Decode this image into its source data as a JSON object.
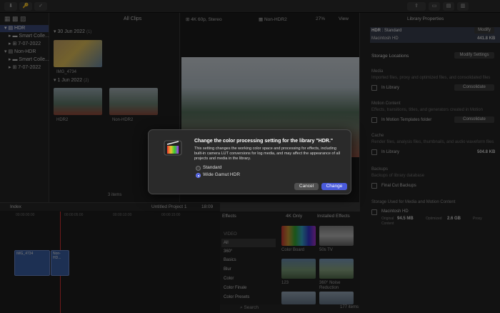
{
  "toolbar": {
    "buttons": [
      "⬇",
      "🔑",
      "✓"
    ],
    "library_properties": "Library Properties"
  },
  "browser": {
    "filter": "All Clips",
    "library_tree": [
      {
        "label": "HDR",
        "selected": true
      },
      {
        "label": "Smart Colle..."
      },
      {
        "label": "7-07-2022"
      },
      {
        "label": "Non-HDR"
      },
      {
        "label": "Smart Colle..."
      },
      {
        "label": "7-07-2022"
      }
    ],
    "events": [
      {
        "date": "30 Jun 2022",
        "count": "(1)",
        "clips": [
          "IMG_4734"
        ]
      },
      {
        "date": "1 Jun 2022",
        "count": "(2)",
        "clips": [
          "HDR2",
          "Non-HDR2"
        ]
      }
    ],
    "item_count": "3 items"
  },
  "viewer": {
    "format": "4K 60p, Stereo",
    "clip_name": "Non-HDR2",
    "zoom": "27%",
    "view": "View"
  },
  "inspector": {
    "library_name": "HDR",
    "library_format": "Standard",
    "modify_label": "Modify",
    "drive": "Macintosh HD",
    "drive_size": "441.8 KB",
    "storage_locations": "Storage Locations",
    "modify_settings": "Modify Settings",
    "sections": [
      {
        "title": "Media",
        "desc": "Imported files, proxy and optimized files, and consolidated files",
        "location": "In Library",
        "button": "Consolidate"
      },
      {
        "title": "Motion Content",
        "desc": "Effects, transitions, titles, and generators created in Motion",
        "location": "In Motion Templates folder",
        "button": "Consolidate"
      },
      {
        "title": "Cache",
        "desc": "Render files, analysis files, thumbnails, and audio waveform files",
        "location": "In Library",
        "value": "504.8 KB"
      },
      {
        "title": "Backups",
        "desc": "Backups of library database",
        "location": "Final Cut Backups"
      }
    ],
    "storage_used": "Storage Used for Media and Motion Content",
    "storage_drive": "Macintosh HD",
    "original_label": "Original",
    "original_value": "94.5 MB",
    "optimized_label": "Optimized",
    "optimized_value": "2.6 GB",
    "proxy_label": "Proxy",
    "content_label": "Content"
  },
  "timeline": {
    "index_label": "Index",
    "project": "Untitled Project 1",
    "timecode": "18:09",
    "ruler": [
      "00:00:00:00",
      "00:00:05:00",
      "00:00:10:00",
      "00:00:15:00"
    ],
    "clips": [
      "IMG_4734",
      "Non-HD..."
    ]
  },
  "effects": {
    "title": "Effects",
    "filter": "4K Only",
    "installed": "Installed Effects",
    "categories": [
      "VIDEO",
      "All",
      "360°",
      "Basics",
      "Blur",
      "Color",
      "Color Finale",
      "Color Presets"
    ],
    "items": [
      "Color Board",
      "50s TV",
      "123",
      "360° Noise Reduction"
    ],
    "search": "Search",
    "count": "177 items"
  },
  "dialog": {
    "title": "Change the color processing setting for the library \"HDR.\"",
    "body": "This setting changes the working color space and processing for effects, including built-in camera LUT conversions for log media, and may affect the appearance of all projects and media in the library.",
    "options": [
      "Standard",
      "Wide Gamut HDR"
    ],
    "selected": "Wide Gamut HDR",
    "cancel": "Cancel",
    "change": "Change"
  },
  "colors": {
    "accent": "#4a5bdc",
    "selection": "#3b4a7a"
  }
}
